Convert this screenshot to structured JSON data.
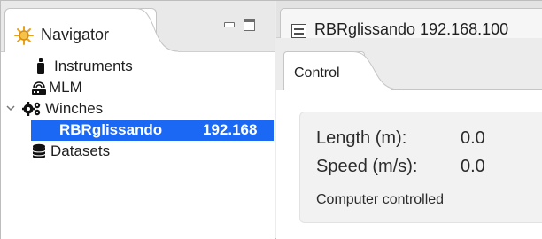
{
  "navigator": {
    "title": "Navigator",
    "items": [
      {
        "label": "Instruments",
        "icon": "instrument-icon"
      },
      {
        "label": "MLM",
        "icon": "mlm-icon"
      },
      {
        "label": "Winches",
        "icon": "gears-icon",
        "expanded": true
      },
      {
        "label": "RBRglissando",
        "address": "192.168",
        "selected": true
      },
      {
        "label": "Datasets",
        "icon": "database-icon"
      }
    ]
  },
  "editor": {
    "tab_title": "RBRglissando 192.168.100",
    "subtab": "Control",
    "fields": {
      "length_label": "Length (m):",
      "length_value": "0.0",
      "speed_label": "Speed (m/s):",
      "speed_value": "0.0"
    },
    "status": "Computer controlled"
  },
  "colors": {
    "selection": "#1b68f4",
    "navigator_icon": "#e8a21a"
  }
}
